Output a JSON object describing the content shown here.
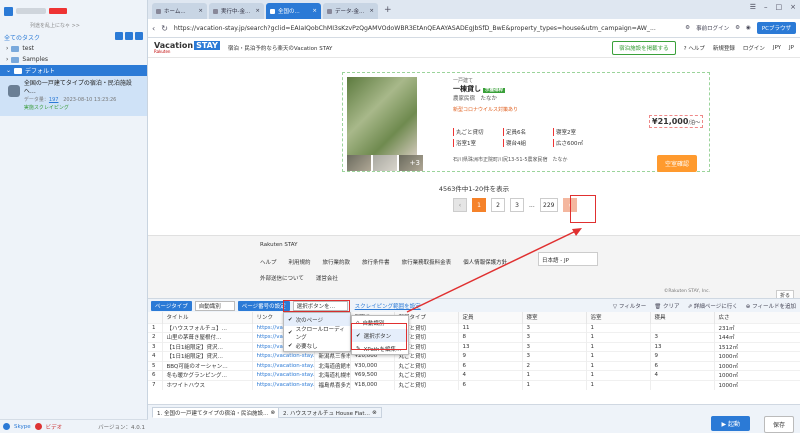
{
  "sidebar": {
    "collapse_label": "列途を乱上になゃ >>",
    "all_tasks": "全てのタスク",
    "tree": [
      {
        "label": "test"
      },
      {
        "label": "Samples"
      },
      {
        "label": "デフォルト"
      }
    ],
    "task": {
      "title": "全国の一戸建てタイプの宿泊・民泊施設へ…",
      "data_label": "データ量：",
      "data_count": "197",
      "date": "2023-08-10 13:23:26",
      "status": "実施スクレイピング"
    },
    "footer": {
      "skype": "Skype",
      "video": "ビデオ",
      "version": "バージョン：4.0.1"
    }
  },
  "browser": {
    "tabs": [
      {
        "label": "ホーム..."
      },
      {
        "label": "実行中-金..."
      },
      {
        "label": "全国の..."
      },
      {
        "label": "データ-金..."
      }
    ],
    "url": "https://vacation-stay.jp/search?gclid=EAIaIQobChMI3sKzvPzQgAMVOdoWBR3EtAnQEAAYASADEgJbSfD_BwE&property_types=house&utm_campaign=AW_...",
    "addr_right": {
      "login": "事前ログイン",
      "pc": "PCブラウザ"
    }
  },
  "web": {
    "logo": "Vacation",
    "logo_stay": "STAY",
    "logo_sub": "Rakuten",
    "tagline": "宿泊・民泊予約なら楽天のVacation STAY",
    "header_btn": "宿泊施設を掲載する",
    "help": "ヘルプ",
    "signup": "新規登録",
    "login": "ログイン",
    "currency": "JPY",
    "lang": "JP",
    "card": {
      "type": "一戸建て",
      "name": "一棟貸し",
      "badge": "ポ獲得枠",
      "loc": "農家民宿　たなか",
      "covid": "新型コロナウイルス対策あり",
      "amenities": [
        "丸ごと貸切",
        "定員6名",
        "寝室2室",
        "浴室1室",
        "寝台4組",
        "広さ600㎡"
      ],
      "address": "石川県珠洲市正院町川尻13-51-5農家民宿　たなか",
      "price": "¥21,000",
      "price_unit": "/泊〜",
      "detail_btn": "空室確認",
      "more": "+3"
    },
    "count_text": "4563件中1-20件を表示",
    "pager": [
      "‹",
      "1",
      "2",
      "3",
      "...",
      "229",
      "›"
    ],
    "footer": {
      "brand": "Rakuten STAY",
      "links": [
        "ヘルプ",
        "利用規約",
        "旅行業約款",
        "旅行条件書",
        "旅行業務取扱料金表",
        "個人情報保護方針",
        "外部送信について",
        "運営会社"
      ],
      "lang": "日本語 - JP",
      "copyright": "©Rakuten STAY, Inc.",
      "collapse": "折る"
    }
  },
  "extract": {
    "page_type_btn": "ページタイプ",
    "page_type_val": "自動識別",
    "pageflip_btn": "ページ番号の設定",
    "pageflip_val": "選択ボタンを…",
    "scroll_link": "スクレイピング範囲を設定",
    "right": [
      "フィルター",
      "クリア",
      "詳細ページに行く",
      "フィールドを追加"
    ],
    "columns": [
      "",
      "タイトル",
      "リンク",
      "",
      "間取り",
      "部屋タイプ",
      "定員",
      "寝室",
      "浴室",
      "寝具",
      "広さ"
    ],
    "rows": [
      [
        "1",
        "【ハウスフォルチュ】…",
        "https://vacation-stay.jp/l/…",
        "",
        "",
        "丸ごと貸切",
        "11",
        "3",
        "1",
        "",
        "231㎡"
      ],
      [
        "2",
        "山里の茅葺き屋根付…",
        "https://vacation-stay.jp/l/…",
        "",
        "",
        "丸ごと貸切",
        "8",
        "3",
        "1",
        "3",
        "144㎡"
      ],
      [
        "3",
        "【1日1組限定】貸沢…",
        "https://vacation-stay.jp/l/…",
        "県地市",
        "¥20,000",
        "丸ごと貸切",
        "13",
        "3",
        "1",
        "13",
        "1512㎡"
      ],
      [
        "4",
        "【1日1組限定】貸沢…",
        "https://vacation-stay.jp/l/…",
        "新潟県三条市…",
        "¥20,000",
        "丸ごと貸切",
        "9",
        "3",
        "1",
        "9",
        "1000㎡"
      ],
      [
        "5",
        "BBQ可能のオーシャン…",
        "https://vacation-stay.jp/l/…",
        "北海道函館市…",
        "¥30,000",
        "丸ごと貸切",
        "6",
        "2",
        "1",
        "6",
        "1000㎡"
      ],
      [
        "6",
        "冬も暖かグランピング…",
        "https://vacation-stay.jp/l/…",
        "北海道札幌市…",
        "¥69,500",
        "丸ごと貸切",
        "4",
        "1",
        "1",
        "4",
        "1000㎡"
      ],
      [
        "7",
        "ホワイトハウス",
        "https://vacation-stay.jp/l/…",
        "福島県喜多方市…",
        "¥18,000",
        "丸ごと貸切",
        "6",
        "1",
        "1",
        "",
        "1000㎡"
      ]
    ],
    "dropdown1": [
      "次のページ",
      "スクロールローディング",
      "必要なし"
    ],
    "dropdown2": [
      "自動識別",
      "選択ボタン",
      "XPathを編集…"
    ]
  },
  "bottom": {
    "tabs": [
      "1. 全国の一戸建てタイプの宿泊・民泊施設…",
      "2. ハウスフォルチュ House Fiat…"
    ],
    "run": "▶ 起動",
    "save": "保存"
  }
}
